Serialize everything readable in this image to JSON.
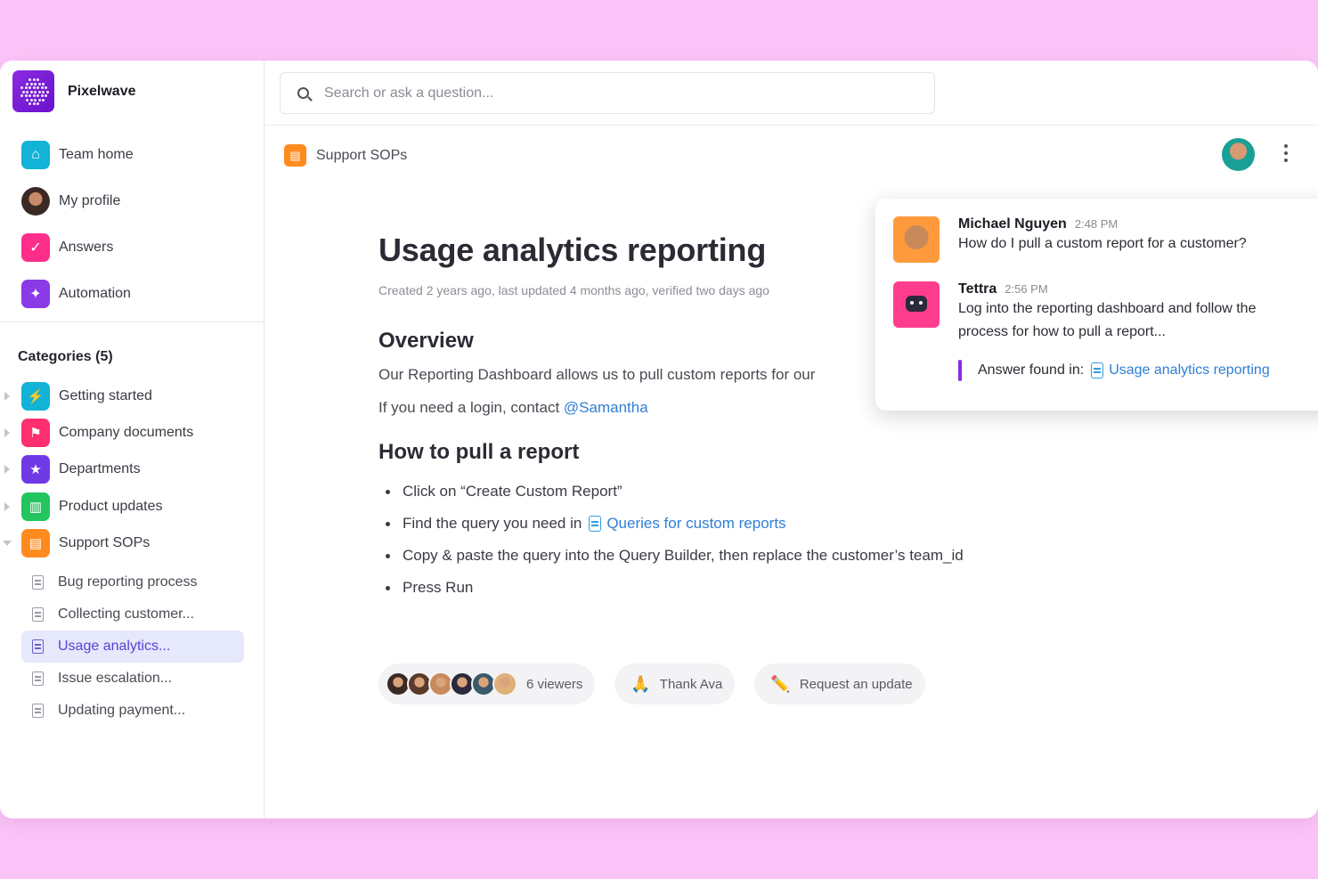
{
  "brand": {
    "name": "Pixelwave"
  },
  "nav": [
    {
      "label": "Team home",
      "icon": "home-icon",
      "color": "#12b3d6"
    },
    {
      "label": "My profile",
      "icon": "avatar",
      "color": "#6b4a3a"
    },
    {
      "label": "Answers",
      "icon": "check-bubble-icon",
      "color": "#ff2e8a"
    },
    {
      "label": "Automation",
      "icon": "sparkle-icon",
      "color": "#8a3ae6"
    }
  ],
  "categories": {
    "title": "Categories (5)",
    "items": [
      {
        "label": "Getting started",
        "icon": "bolt-icon",
        "color": "#12b3d6"
      },
      {
        "label": "Company documents",
        "icon": "flag-icon",
        "color": "#ff2e6e"
      },
      {
        "label": "Departments",
        "icon": "star-icon",
        "color": "#6f3ae6"
      },
      {
        "label": "Product updates",
        "icon": "map-icon",
        "color": "#22c55e"
      },
      {
        "label": "Support SOPs",
        "icon": "cart-icon",
        "color": "#ff8a1e"
      }
    ]
  },
  "docs": [
    {
      "label": "Bug reporting process"
    },
    {
      "label": "Collecting customer..."
    },
    {
      "label": "Usage analytics..."
    },
    {
      "label": "Issue escalation..."
    },
    {
      "label": "Updating payment..."
    }
  ],
  "search": {
    "placeholder": "Search or ask a question..."
  },
  "breadcrumb": {
    "label": "Support SOPs"
  },
  "article": {
    "title": "Usage analytics reporting",
    "meta": "Created 2 years ago, last updated 4 months ago, verified two days ago",
    "overview_heading": "Overview",
    "overview_text": "Our Reporting Dashboard allows us to pull custom reports for our",
    "login_text": "If you need a login, contact ",
    "login_mention": "@Samantha",
    "howto_heading": "How to pull a report",
    "step1": "Click on “Create Custom Report”",
    "step2_text": "Find the query you need in",
    "step2_link": "Queries for custom reports",
    "step3": "Copy & paste the query into the Query Builder, then replace the customer’s team_id",
    "step4": "Press Run"
  },
  "footer": {
    "viewers": "6 viewers",
    "thank": "Thank Ava",
    "request": "Request an update",
    "viewer_colors": [
      "#3b2a24",
      "#5a3a2a",
      "#c88a5a",
      "#2a2a3a",
      "#3a5a6a",
      "#e0b07a"
    ]
  },
  "chat": {
    "message1": {
      "name": "Michael Nguyen",
      "time": "2:48 PM",
      "text": "How do I pull a custom report for a customer?"
    },
    "message2": {
      "name": "Tettra",
      "time": "2:56 PM",
      "text_line1": "Log into the reporting dashboard and follow the",
      "text_line2": "process for how to pull a report..."
    },
    "answer_label": "Answer found in:",
    "answer_link": "Usage analytics reporting"
  },
  "colors": {
    "background": "#fbc4f8",
    "accent": "#5b3fd6",
    "link": "#2f7fd6"
  }
}
